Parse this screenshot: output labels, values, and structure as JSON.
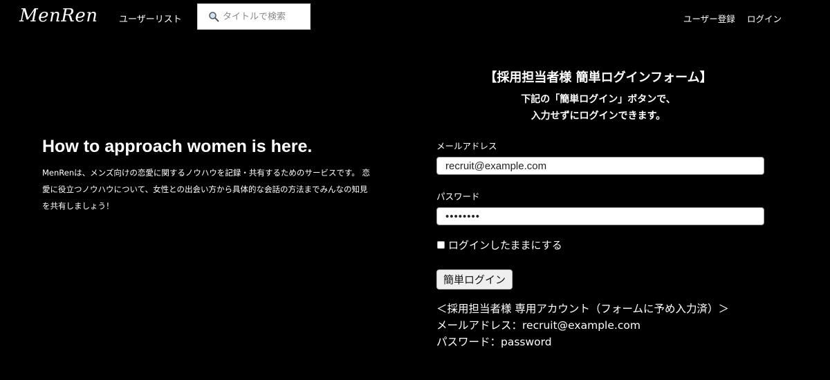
{
  "header": {
    "logo": "MenRen",
    "nav_user_list": "ユーザーリスト",
    "search_placeholder": "タイトルで検索",
    "search_icon": "search-icon",
    "nav_register": "ユーザー登録",
    "nav_login": "ログイン"
  },
  "hero": {
    "title": "How to approach women is here.",
    "description": "MenRenは、メンズ向けの恋愛に関するノウハウを記録・共有するためのサービスです。 恋愛に役立つノウハウについて、女性との出会い方から具体的な会話の方法までみんなの知見を共有しましょう！"
  },
  "login_form": {
    "heading": "【採用担当者様 簡単ログインフォーム】",
    "sub_line1": "下記の「簡単ログイン」ボタンで、",
    "sub_line2": "入力せずにログインできます。",
    "email_label": "メールアドレス",
    "email_value": "recruit@example.com",
    "password_label": "パスワード",
    "password_value": "password",
    "remember_label": "ログインしたままにする",
    "remember_checked": false,
    "submit_label": "簡単ログイン",
    "info_line1": "＜採用担当者様 専用アカウント（フォームに予め入力済）＞",
    "info_line2": "メールアドレス：recruit@example.com",
    "info_line3": "パスワード：password"
  }
}
